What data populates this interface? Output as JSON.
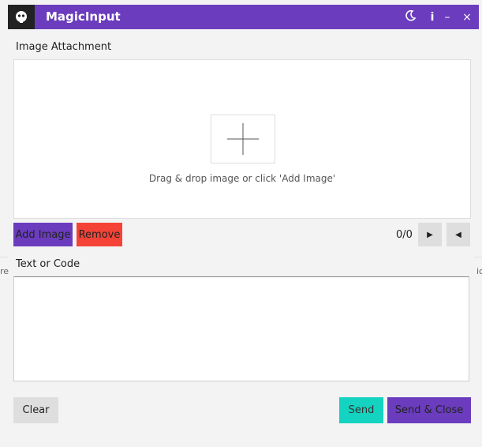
{
  "titlebar": {
    "title": "MagicInput",
    "info_label": "i",
    "minimize_label": "–",
    "close_label": "×"
  },
  "image_section": {
    "label": "Image Attachment",
    "drop_hint": "Drag & drop image or click 'Add Image'",
    "add_label": "Add Image",
    "remove_label": "Remove",
    "counter": "0/0",
    "next_label": "▶",
    "prev_label": "◀"
  },
  "text_section": {
    "label": "Text or Code",
    "value": ""
  },
  "footer": {
    "clear_label": "Clear",
    "send_label": "Send",
    "send_close_label": "Send & Close"
  },
  "edges": {
    "left": "re",
    "right": "ic"
  },
  "colors": {
    "accent": "#6b3cbe",
    "remove": "#f44336",
    "send": "#14d3c0",
    "neutral": "#dedede"
  }
}
